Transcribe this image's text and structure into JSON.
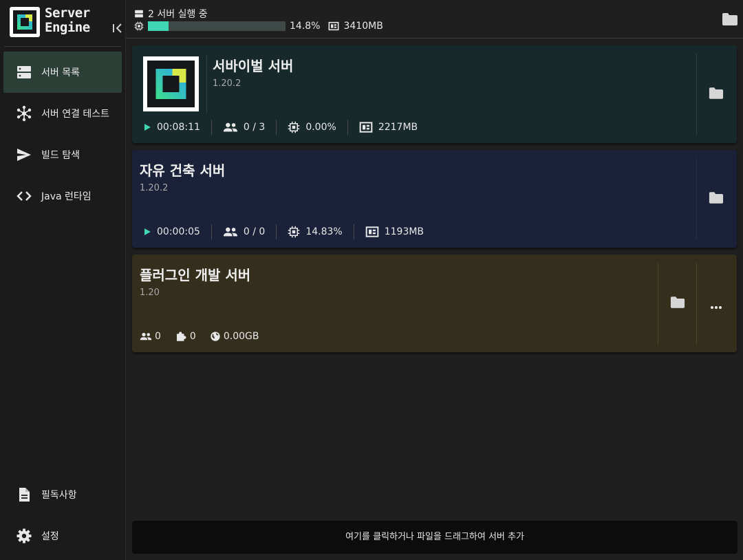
{
  "brand": {
    "line1": "Server",
    "line2": "Engine"
  },
  "sidebar": {
    "items": [
      {
        "label": "서버 목록",
        "icon": "server-list-icon",
        "active": true
      },
      {
        "label": "서버 연결 테스트",
        "icon": "network-hub-icon",
        "active": false
      },
      {
        "label": "빌드 탐색",
        "icon": "send-icon",
        "active": false
      },
      {
        "label": "Java 런타임",
        "icon": "code-brackets-icon",
        "active": false
      }
    ],
    "bottom": [
      {
        "label": "필독사항",
        "icon": "document-icon"
      },
      {
        "label": "설정",
        "icon": "gear-icon"
      }
    ]
  },
  "topbar": {
    "running_text": "2 서버 실행 중",
    "cpu_percent_text": "14.8%",
    "cpu_fraction": 0.148,
    "memory_text": "3410MB"
  },
  "servers": [
    {
      "name": "서바이벌 서버",
      "version": "1.20.2",
      "uptime": "00:08:11",
      "players": "0 / 3",
      "cpu": "0.00%",
      "memory": "2217MB",
      "color": "#17292a"
    },
    {
      "name": "자유 건축 서버",
      "version": "1.20.2",
      "uptime": "00:00:05",
      "players": "0 / 0",
      "cpu": "14.83%",
      "memory": "1193MB",
      "color": "#1a2138"
    },
    {
      "name": "플러그인 개발 서버",
      "version": "1.20",
      "players": "0",
      "plugins": "0",
      "storage": "0.00GB",
      "color": "#332f1c"
    }
  ],
  "add_server": {
    "label": "여기를 클릭하거나 파일을 드래그하여 서버 추가"
  },
  "colors": {
    "accent": "#3ed6b3",
    "active_nav": "#2c3f36"
  }
}
